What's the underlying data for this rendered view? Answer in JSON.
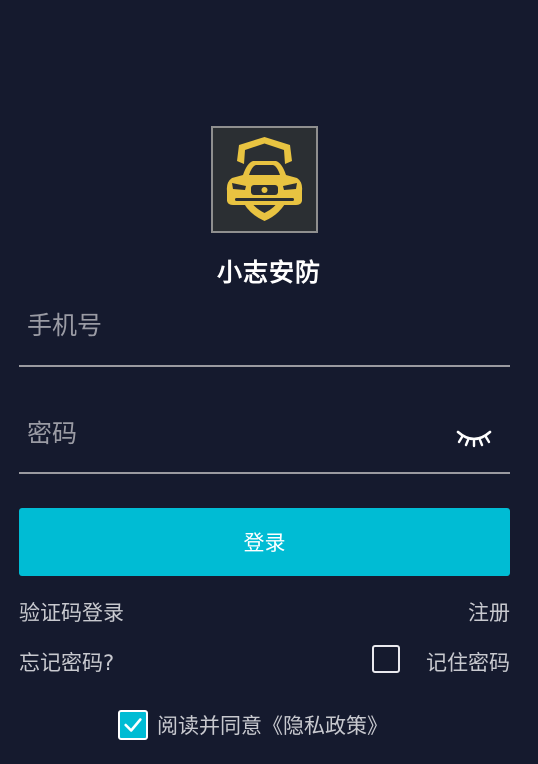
{
  "app": {
    "name": "小志安防",
    "logo_icon": "shield-car-logo-icon"
  },
  "form": {
    "phone_placeholder": "手机号",
    "phone_value": "",
    "password_placeholder": "密码",
    "password_value": "",
    "eye_icon": "eye-closed-icon"
  },
  "actions": {
    "login_label": "登录",
    "sms_login_label": "验证码登录",
    "register_label": "注册",
    "forgot_password_label": "忘记密码?",
    "remember_password_label": "记住密码",
    "remember_checked": false
  },
  "agreement": {
    "checked": true,
    "text": "阅读并同意《隐私政策》"
  },
  "colors": {
    "background": "#151a2e",
    "accent": "#00bcd4",
    "logo_gold": "#e8c341"
  }
}
